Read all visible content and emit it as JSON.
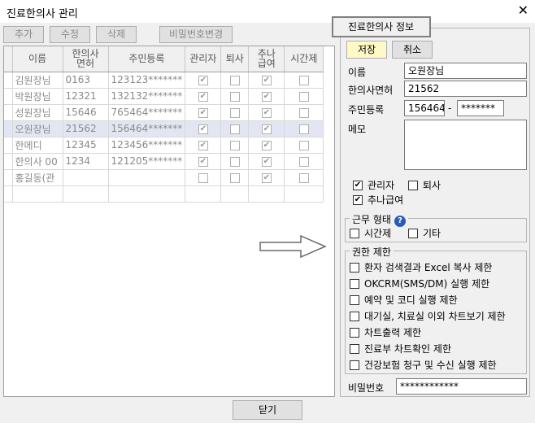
{
  "window": {
    "title": "진료한의사 관리",
    "close": "✕"
  },
  "toolbar": {
    "add": "추가",
    "edit": "수정",
    "delete": "삭제",
    "change_pw": "비밀번호변경"
  },
  "table": {
    "headers": [
      "이름",
      "한의사\n면허",
      "주민등록",
      "관리자",
      "퇴사",
      "추나\n급여",
      "시간제"
    ],
    "rows": [
      {
        "name": "김원장님",
        "license": "0163",
        "rrn": "123123*******",
        "admin": true,
        "retired": false,
        "chuna": true,
        "parttime": false
      },
      {
        "name": "박원장님",
        "license": "12321",
        "rrn": "132132*******",
        "admin": true,
        "retired": false,
        "chuna": true,
        "parttime": false
      },
      {
        "name": "성원장님",
        "license": "15646",
        "rrn": "765464*******",
        "admin": true,
        "retired": false,
        "chuna": true,
        "parttime": false
      },
      {
        "name": "오원장님",
        "license": "21562",
        "rrn": "156464*******",
        "admin": true,
        "retired": false,
        "chuna": true,
        "parttime": false
      },
      {
        "name": "한메디",
        "license": "12345",
        "rrn": "123456*******",
        "admin": true,
        "retired": false,
        "chuna": true,
        "parttime": false
      },
      {
        "name": "한의사 00",
        "license": "1234",
        "rrn": "121205*******",
        "admin": true,
        "retired": false,
        "chuna": true,
        "parttime": false
      },
      {
        "name": "홍길동(관",
        "license": "",
        "rrn": "",
        "admin": false,
        "retired": false,
        "chuna": true,
        "parttime": false
      }
    ]
  },
  "panel": {
    "title": "진료한의사 정보",
    "save": "저장",
    "cancel": "취소",
    "name_label": "이름",
    "name_value": "오원장님",
    "license_label": "한의사면허",
    "license_value": "21562",
    "rrn_label": "주민등록",
    "rrn_front": "156464",
    "rrn_dash": "-",
    "rrn_back": "*******",
    "memo_label": "메모",
    "admin_label": "관리자",
    "retired_label": "퇴사",
    "chuna_label": "추나급여",
    "work_type_label": "근무 형태",
    "help": "?",
    "parttime_label": "시간제",
    "other_label": "기타",
    "perm_label": "권한 제한",
    "perms": [
      "환자 검색결과 Excel 복사 제한",
      "OKCRM(SMS/DM) 실행 제한",
      "예약 및 코디 실행 제한",
      "대기실, 치료실 이외 차트보기 제한",
      "차트출력 제한",
      "진료부 차트확인 제한",
      "건강보험 청구 및 수신 실행 제한"
    ],
    "pw_label": "비밀번호",
    "pw_value": "************"
  },
  "footer": {
    "close": "닫기"
  }
}
